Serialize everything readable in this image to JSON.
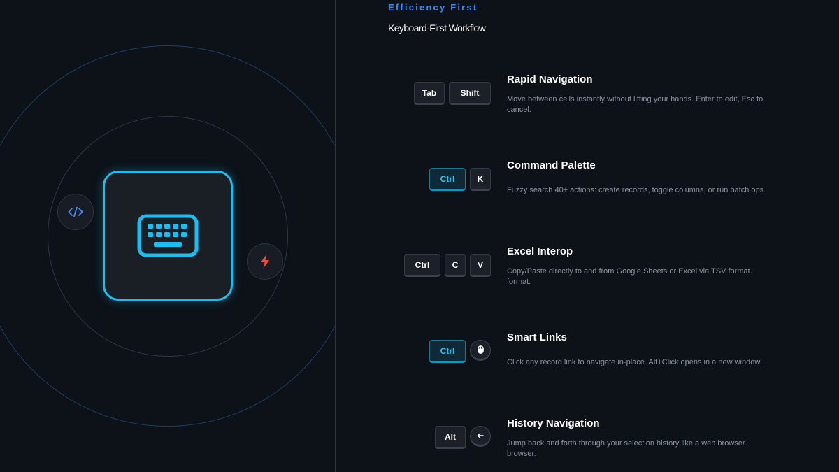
{
  "header": {
    "eyebrow": "Efficiency First",
    "subtitle": "Keyboard-First Workflow"
  },
  "hero": {
    "main_icon": "keyboard-icon",
    "badges": [
      "code-icon",
      "lightning-icon"
    ],
    "accent_color": "#18bff0",
    "code_color": "#4a8cf0",
    "bolt_color": "#f04a3c"
  },
  "features": [
    {
      "title": "Rapid Navigation",
      "desc_lines": [
        "Move between cells instantly without lifting your hands. Enter to edit, Esc to",
        "cancel."
      ],
      "keys": [
        "Tab",
        "Shift"
      ]
    },
    {
      "title": "Command Palette",
      "desc_lines": [
        "Fuzzy search 40+ actions: create records, toggle columns, or run batch ops."
      ],
      "keys": [
        "Ctrl",
        "K"
      ]
    },
    {
      "title": "Excel Interop",
      "desc_lines": [
        "Copy/Paste directly to and from Google Sheets or Excel via TSV format.",
        "format."
      ],
      "keys": [
        "Ctrl",
        "C",
        "V"
      ]
    },
    {
      "title": "Smart Links",
      "desc_lines": [
        "Click any record link to navigate in-place. Alt+Click opens in a new window."
      ],
      "keys": [
        "Ctrl",
        "mouse-icon"
      ]
    },
    {
      "title": "History Navigation",
      "desc_lines": [
        "Jump back and forth through your selection history like a web browser.",
        "browser."
      ],
      "keys": [
        "Alt",
        "arrow-left-icon"
      ]
    }
  ]
}
